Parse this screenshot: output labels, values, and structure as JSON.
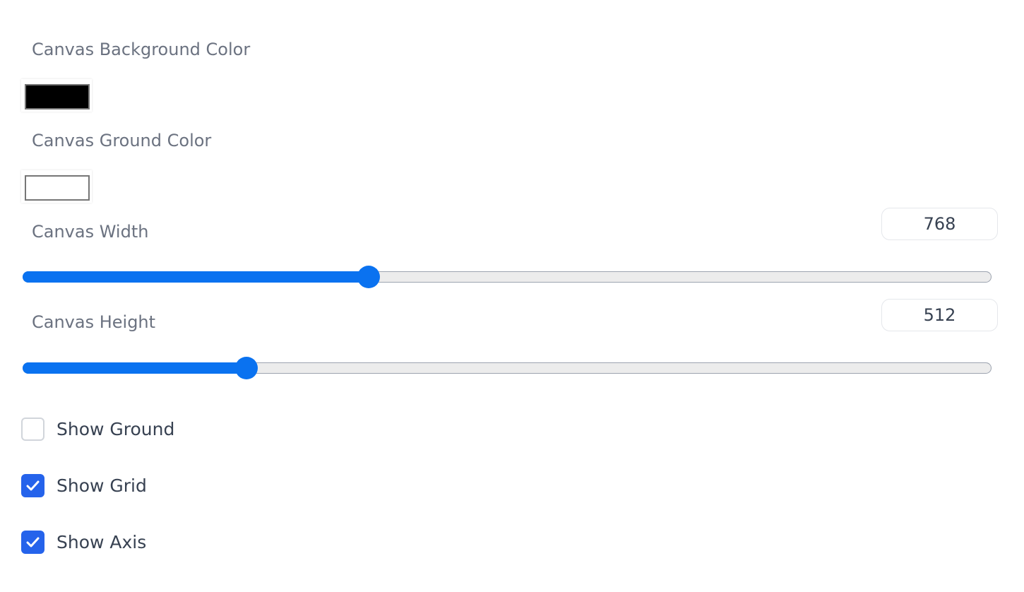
{
  "settings": {
    "background_color": {
      "label": "Canvas Background Color",
      "value": "#000000"
    },
    "ground_color": {
      "label": "Canvas Ground Color",
      "value": "#ffffff"
    },
    "width": {
      "label": "Canvas Width",
      "value": "768",
      "fraction": 0.357
    },
    "height": {
      "label": "Canvas Height",
      "value": "512",
      "fraction": 0.231
    },
    "show_ground": {
      "label": "Show Ground",
      "checked": false
    },
    "show_grid": {
      "label": "Show Grid",
      "checked": true
    },
    "show_axis": {
      "label": "Show Axis",
      "checked": true
    }
  },
  "colors": {
    "accent": "#0a72f0",
    "checkbox_checked": "#2563eb",
    "label_text": "#6b7280"
  }
}
